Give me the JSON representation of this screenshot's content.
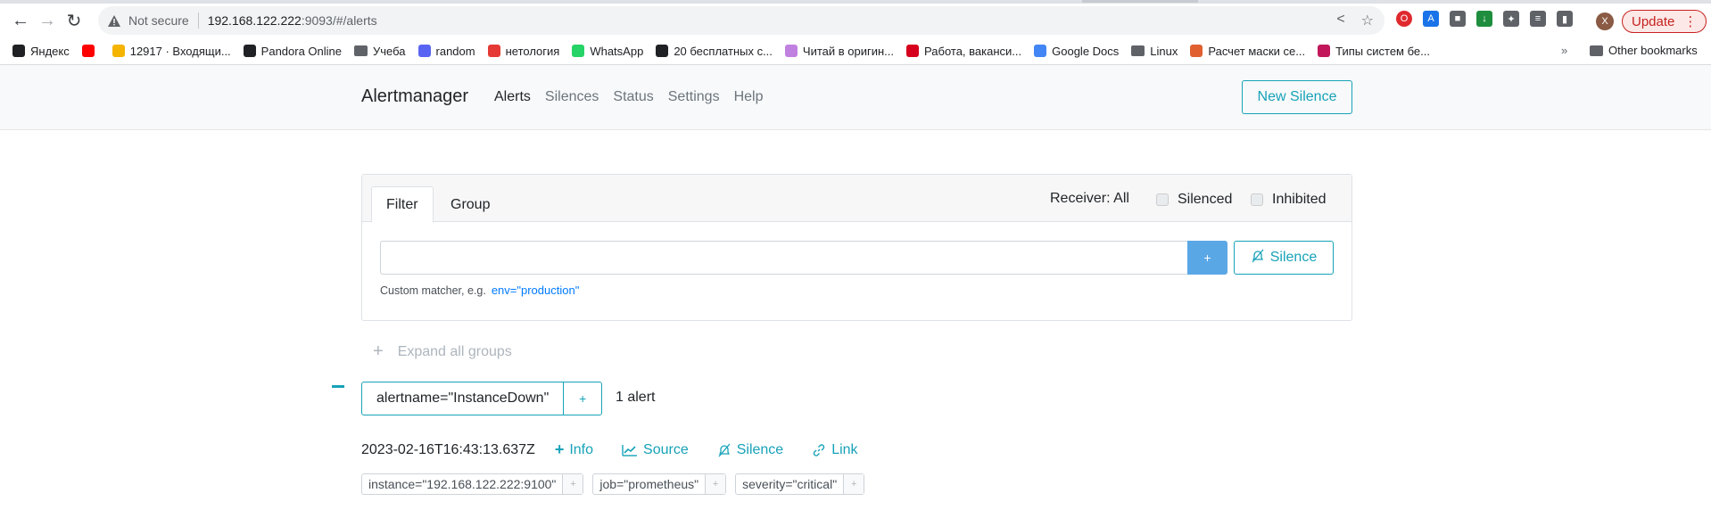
{
  "browser": {
    "security_label": "Not secure",
    "url_host": "192.168.122.222",
    "url_path": ":9093/#/alerts",
    "update_label": "Update",
    "profile_initial": "X",
    "bookmarks": [
      {
        "label": "Яндекс",
        "icon": "yandex-icon",
        "color": "#202124"
      },
      {
        "label": "",
        "icon": "youtube-icon",
        "color": "#ff0000"
      },
      {
        "label": "12917 · Входящи...",
        "icon": "mail-icon",
        "color": "#f4b400"
      },
      {
        "label": "Pandora Online",
        "icon": "headphones-icon",
        "color": "#202124"
      },
      {
        "label": "Учеба",
        "icon": "folder-icon",
        "color": "#5f6368"
      },
      {
        "label": "random",
        "icon": "discord-icon",
        "color": "#5865f2"
      },
      {
        "label": "нетология",
        "icon": "netology-icon",
        "color": "#e53935"
      },
      {
        "label": "WhatsApp",
        "icon": "whatsapp-icon",
        "color": "#25d366"
      },
      {
        "label": "20 бесплатных с...",
        "icon": "globe-icon",
        "color": "#202124"
      },
      {
        "label": "Читай в оригин...",
        "icon": "grid-icon",
        "color": "#c080e0"
      },
      {
        "label": "Работа, ваканси...",
        "icon": "hh-icon",
        "color": "#d6001c"
      },
      {
        "label": "Google Docs",
        "icon": "docs-icon",
        "color": "#4285f4"
      },
      {
        "label": "Linux",
        "icon": "folder-icon",
        "color": "#5f6368"
      },
      {
        "label": "Расчет маски се...",
        "icon": "calc-icon",
        "color": "#e06030"
      },
      {
        "label": "Типы систем бе...",
        "icon": "doc-icon",
        "color": "#c2185b"
      }
    ],
    "other_bookmarks": "Other bookmarks"
  },
  "app": {
    "brand": "Alertmanager",
    "nav": [
      "Alerts",
      "Silences",
      "Status",
      "Settings",
      "Help"
    ],
    "new_silence": "New Silence"
  },
  "filter": {
    "tab_filter": "Filter",
    "tab_group": "Group",
    "receiver": "Receiver: All",
    "silenced": "Silenced",
    "inhibited": "Inhibited",
    "input_value": "",
    "plus_label": "+",
    "silence_label": "Silence",
    "hint_text": "Custom matcher, e.g.",
    "hint_code": "env=\"production\""
  },
  "expand_all": "Expand all groups",
  "group": {
    "label": "alertname=\"InstanceDown\"",
    "add": "+",
    "count": "1 alert"
  },
  "alert": {
    "timestamp": "2023-02-16T16:43:13.637Z",
    "actions": [
      "Info",
      "Source",
      "Silence",
      "Link"
    ],
    "labels": [
      "instance=\"192.168.122.222:9100\"",
      "job=\"prometheus\"",
      "severity=\"critical\""
    ]
  }
}
